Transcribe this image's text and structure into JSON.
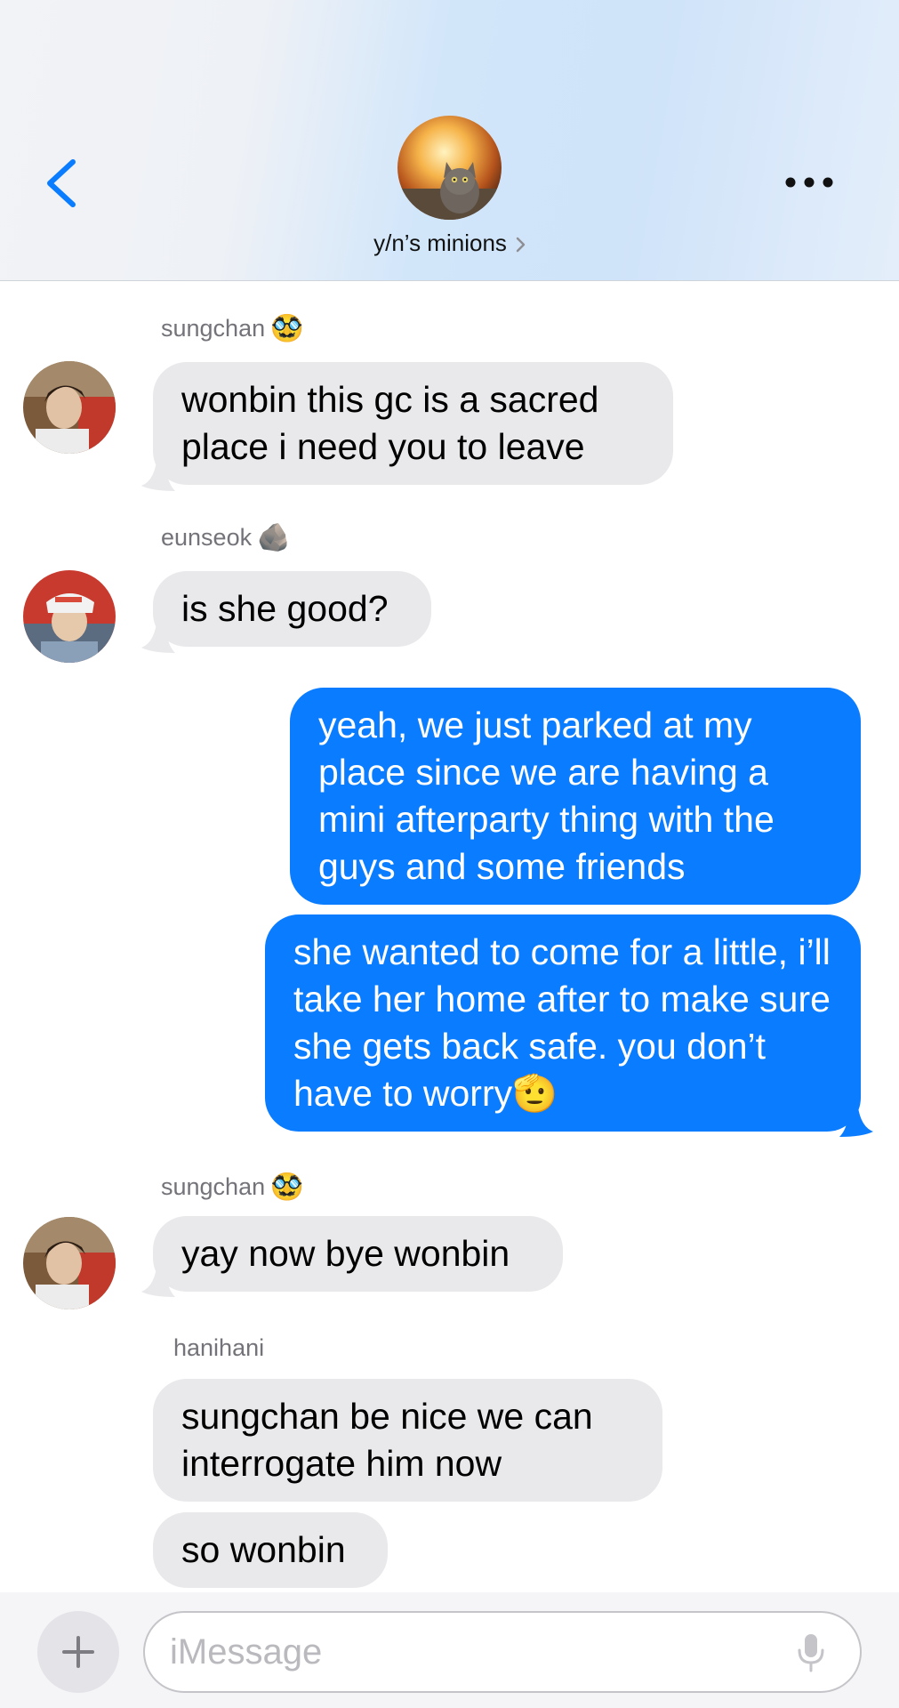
{
  "header": {
    "group_name": "y/n’s minions",
    "back_icon": "chevron-left-icon",
    "more_icon": "ellipsis-icon",
    "avatar": "cat-explosion-group-avatar"
  },
  "messages": {
    "m1": {
      "sender": "sungchan",
      "sender_emoji": "🥸",
      "text": "wonbin this gc is a sacred place i need you to leave"
    },
    "m2": {
      "sender": "eunseok",
      "sender_emoji": "🪨",
      "text": "is she good?"
    },
    "m3": {
      "text": "yeah, we just parked at my place since we are having a mini afterparty thing with the guys and some friends"
    },
    "m4": {
      "text": "she wanted to come for a little, i’ll take her home after to make sure she gets back safe. you don’t have to worry🫡"
    },
    "m5": {
      "sender": "sungchan",
      "sender_emoji": "🥸",
      "text": "yay now bye wonbin"
    },
    "m6": {
      "sender": "hanihani",
      "text": "sungchan be nice we can interrogate him now"
    },
    "m7": {
      "text": "so wonbin"
    }
  },
  "input": {
    "placeholder": "iMessage",
    "plus_icon": "plus-icon",
    "mic_icon": "microphone-icon"
  },
  "colors": {
    "outgoing_bubble": "#0a7cff",
    "incoming_bubble": "#e9e9eb",
    "accent": "#0a7cff"
  }
}
